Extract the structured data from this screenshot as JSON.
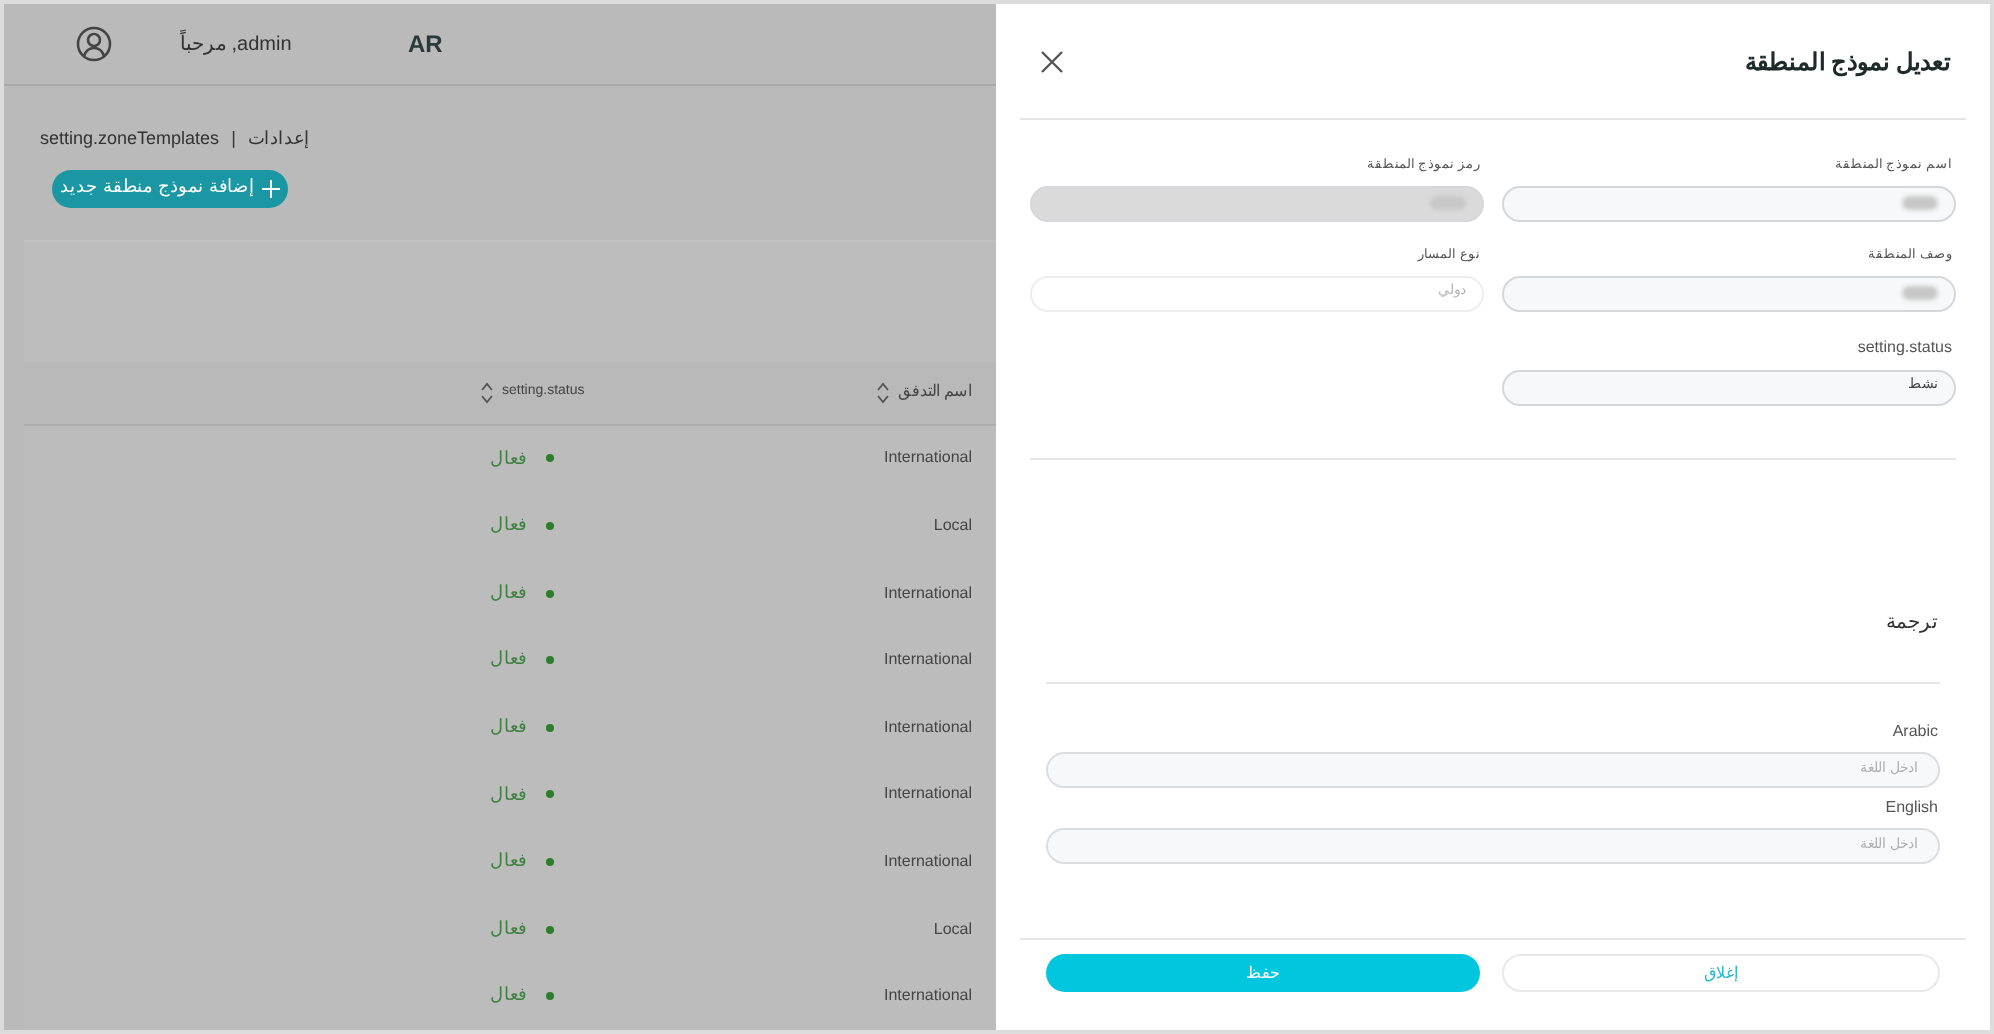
{
  "header": {
    "language": "AR",
    "greeting": "مرحباً ,admin"
  },
  "breadcrumb": [
    "إعدادات",
    "|",
    "setting.zoneTemplates"
  ],
  "add_button": {
    "label": "إضافة نموذج منطقة جديد"
  },
  "table": {
    "columns": [
      "اسم التدفق",
      "setting.status"
    ],
    "rows": [
      {
        "flow_name": "International",
        "status": "فعال",
        "active": true
      },
      {
        "flow_name": "Local",
        "status": "فعال",
        "active": true
      },
      {
        "flow_name": "International",
        "status": "فعال",
        "active": true
      },
      {
        "flow_name": "International",
        "status": "فعال",
        "active": true
      },
      {
        "flow_name": "International",
        "status": "فعال",
        "active": true
      },
      {
        "flow_name": "International",
        "status": "فعال",
        "active": true
      },
      {
        "flow_name": "International",
        "status": "فعال",
        "active": true
      },
      {
        "flow_name": "Local",
        "status": "فعال",
        "active": true
      },
      {
        "flow_name": "International",
        "status": "فعال",
        "active": true
      }
    ]
  },
  "drawer": {
    "title": "تعديل نموذج المنطقة",
    "fields": [
      {
        "label": "اسم نموذج المنطقة",
        "redacted": true,
        "disabled": false,
        "readonly": false
      },
      {
        "label": "رمز نموذج المنطقة",
        "redacted": true,
        "disabled": true,
        "readonly": false
      },
      {
        "label": "وصف المنطقة",
        "redacted": true,
        "disabled": false,
        "readonly": false
      },
      {
        "label": "نوع المسار",
        "value": "دولي",
        "disabled": false,
        "readonly": true
      },
      {
        "label": "setting.status",
        "value": "نشط",
        "disabled": false,
        "readonly": false
      }
    ],
    "translation": {
      "title": "ترجمة",
      "languages": [
        {
          "label": "Arabic",
          "placeholder": "ادخل اللغة"
        },
        {
          "label": "English",
          "placeholder": "ادخل اللغة"
        }
      ]
    },
    "buttons": {
      "save": "حفظ",
      "close": "إغلاق"
    }
  }
}
